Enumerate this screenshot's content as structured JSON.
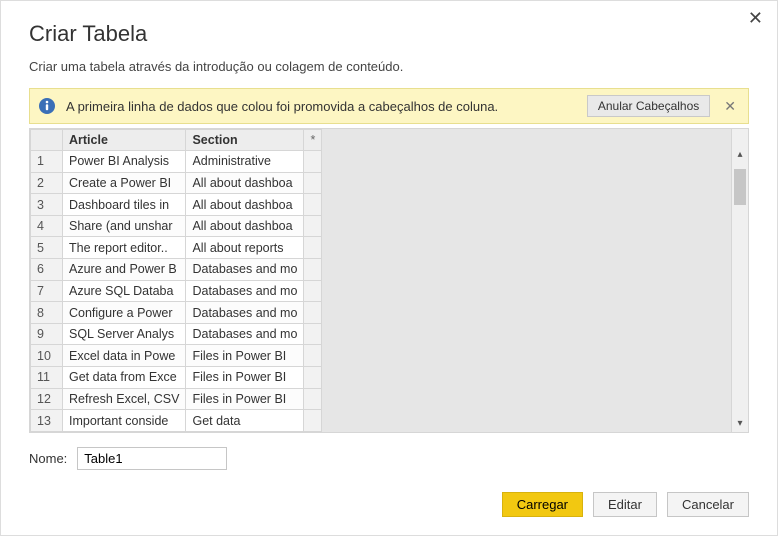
{
  "dialog": {
    "title": "Criar Tabela",
    "subtitle": "Criar uma tabela através da introdução ou colagem de conteúdo."
  },
  "banner": {
    "message": "A primeira linha de dados que colou foi promovida a cabeçalhos de coluna.",
    "action_label": "Anular Cabeçalhos"
  },
  "table": {
    "headers": {
      "col1": "Article",
      "col2": "Section",
      "star": "*"
    },
    "rows": [
      {
        "n": "1",
        "article": "Power BI Analysis",
        "section": "Administrative"
      },
      {
        "n": "2",
        "article": "Create a Power BI",
        "section": "All about dashboa"
      },
      {
        "n": "3",
        "article": "Dashboard tiles in",
        "section": "All about dashboa"
      },
      {
        "n": "4",
        "article": "Share (and unshar",
        "section": "All about dashboa"
      },
      {
        "n": "5",
        "article": "The report editor..",
        "section": "All about reports"
      },
      {
        "n": "6",
        "article": "Azure and Power B",
        "section": "Databases and mo"
      },
      {
        "n": "7",
        "article": "Azure SQL Databa",
        "section": "Databases and mo"
      },
      {
        "n": "8",
        "article": "Configure a Power",
        "section": "Databases and mo"
      },
      {
        "n": "9",
        "article": "SQL Server Analys",
        "section": "Databases and mo"
      },
      {
        "n": "10",
        "article": "Excel data in Powe",
        "section": "Files in Power BI"
      },
      {
        "n": "11",
        "article": "Get data from Exce",
        "section": "Files in Power BI"
      },
      {
        "n": "12",
        "article": "Refresh Excel, CSV",
        "section": "Files in Power BI"
      },
      {
        "n": "13",
        "article": "Important conside",
        "section": "Get data"
      }
    ]
  },
  "name_field": {
    "label": "Nome:",
    "value": "Table1"
  },
  "buttons": {
    "load": "Carregar",
    "edit": "Editar",
    "cancel": "Cancelar"
  }
}
